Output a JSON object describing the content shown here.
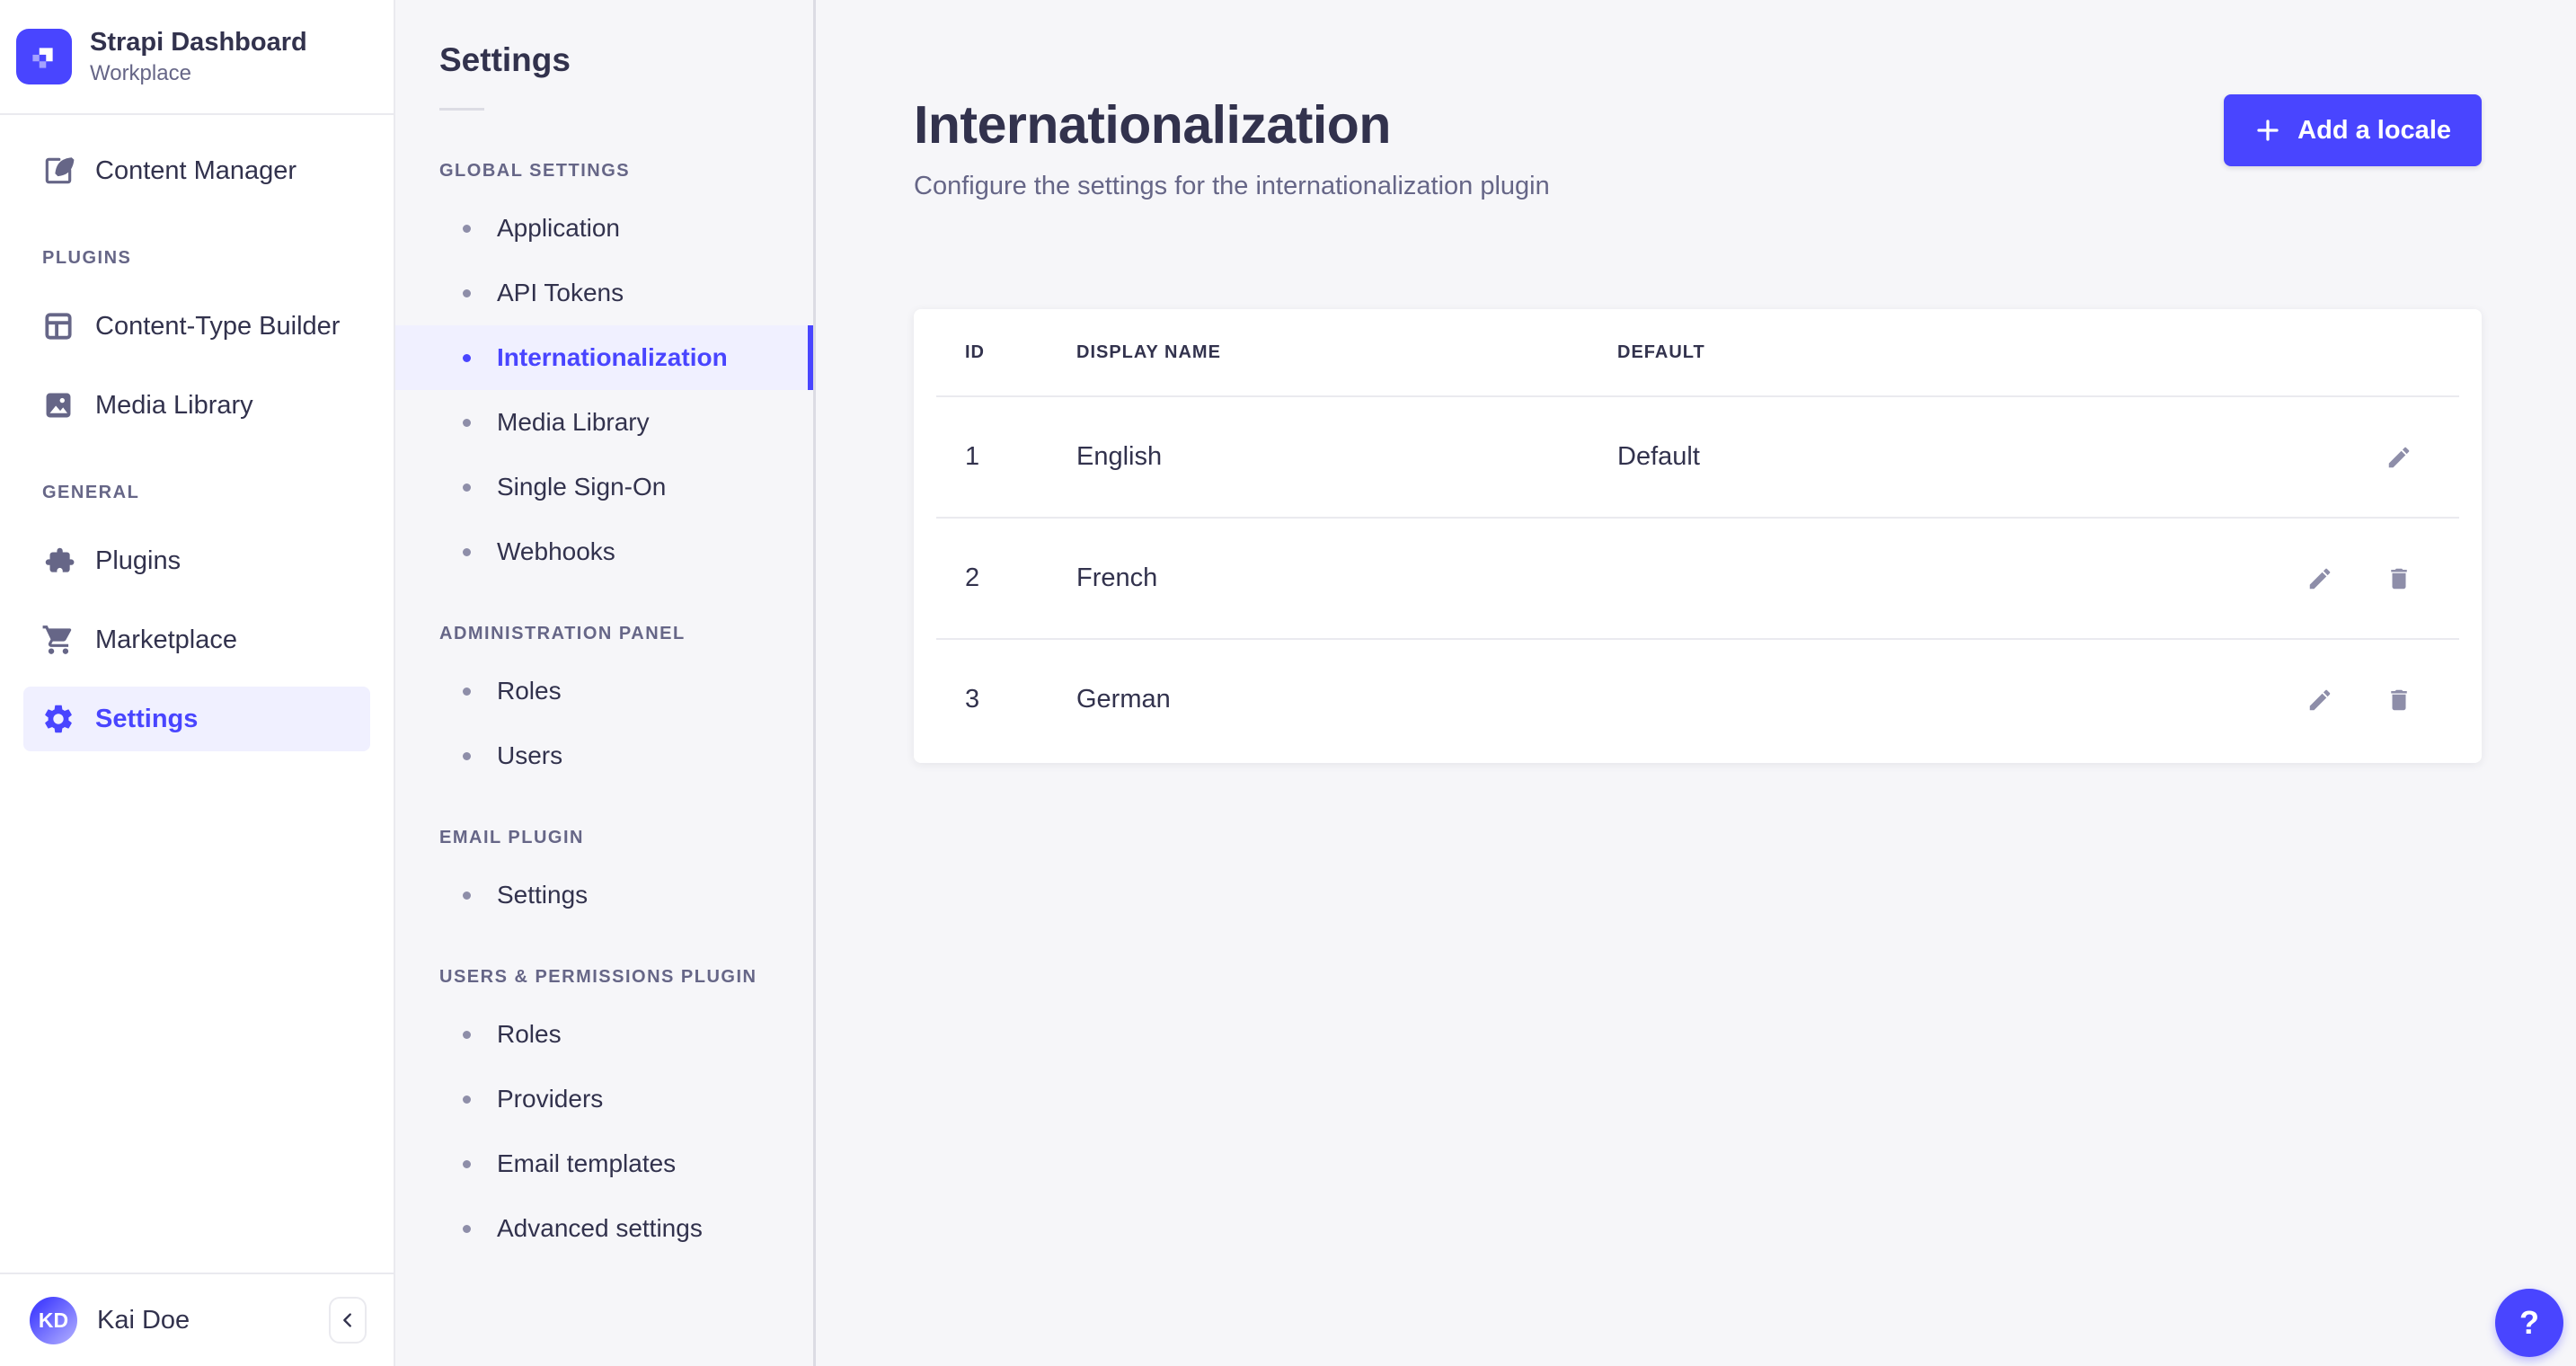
{
  "brand": {
    "title": "Strapi Dashboard",
    "subtitle": "Workplace"
  },
  "colors": {
    "primary": "#4945ff",
    "primary_light_bg": "#f0f0ff",
    "text_dark": "#32324d",
    "text_muted": "#666687",
    "icon_gray": "#8e8ea9",
    "border": "#eaeaef",
    "page_bg": "#f6f6f9",
    "surface": "#ffffff"
  },
  "sidebar": {
    "content_manager": {
      "label": "Content Manager"
    },
    "sections": [
      {
        "title": "PLUGINS",
        "items": [
          {
            "label": "Content-Type Builder"
          },
          {
            "label": "Media Library"
          }
        ]
      },
      {
        "title": "GENERAL",
        "items": [
          {
            "label": "Plugins"
          },
          {
            "label": "Marketplace"
          },
          {
            "label": "Settings",
            "active": true
          }
        ]
      }
    ],
    "user": {
      "name": "Kai Doe",
      "initials": "KD"
    }
  },
  "settings_nav": {
    "title": "Settings",
    "sections": [
      {
        "title": "GLOBAL SETTINGS",
        "items": [
          {
            "label": "Application"
          },
          {
            "label": "API Tokens"
          },
          {
            "label": "Internationalization",
            "active": true
          },
          {
            "label": "Media Library"
          },
          {
            "label": "Single Sign-On"
          },
          {
            "label": "Webhooks"
          }
        ]
      },
      {
        "title": "ADMINISTRATION PANEL",
        "items": [
          {
            "label": "Roles"
          },
          {
            "label": "Users"
          }
        ]
      },
      {
        "title": "EMAIL PLUGIN",
        "items": [
          {
            "label": "Settings"
          }
        ]
      },
      {
        "title": "USERS & PERMISSIONS PLUGIN",
        "items": [
          {
            "label": "Roles"
          },
          {
            "label": "Providers"
          },
          {
            "label": "Email templates"
          },
          {
            "label": "Advanced settings"
          }
        ]
      }
    ]
  },
  "main": {
    "title": "Internationalization",
    "subtitle": "Configure the settings for the internationalization plugin",
    "add_locale_button": "Add a locale",
    "help_button": "?",
    "table": {
      "headers": {
        "id": "ID",
        "display_name": "DISPLAY NAME",
        "default": "DEFAULT"
      },
      "rows": [
        {
          "id": "1",
          "display_name": "English",
          "default": "Default"
        },
        {
          "id": "2",
          "display_name": "French",
          "default": ""
        },
        {
          "id": "3",
          "display_name": "German",
          "default": ""
        }
      ]
    }
  }
}
